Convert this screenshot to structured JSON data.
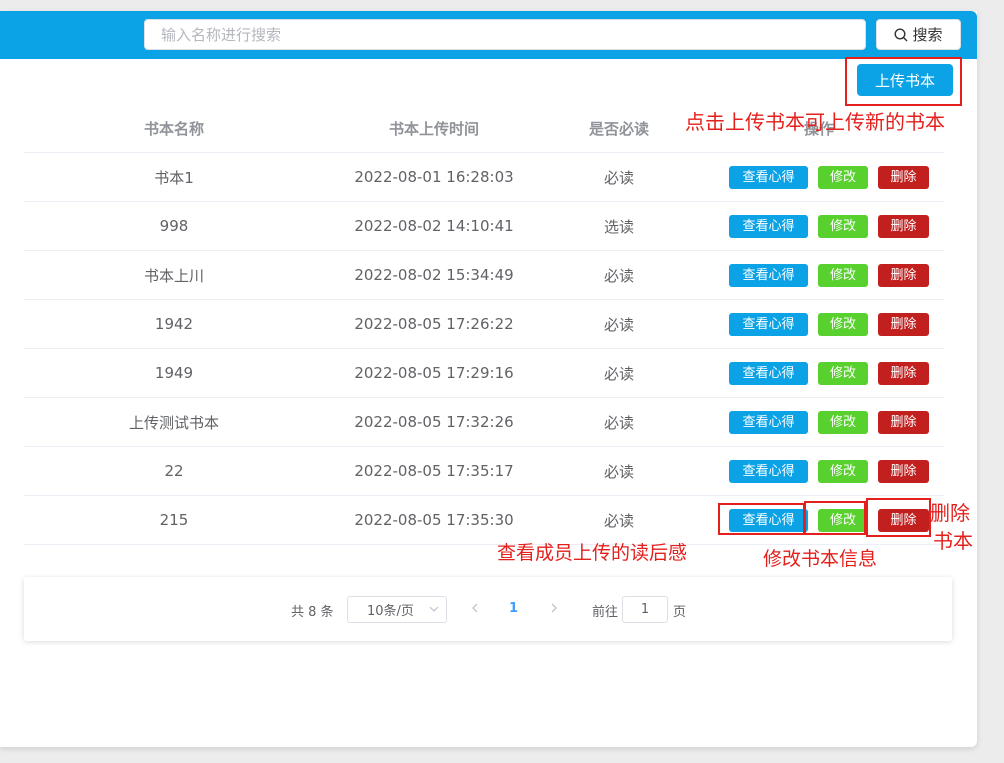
{
  "search": {
    "placeholder": "输入名称进行搜索",
    "value": "",
    "button_label": "搜索"
  },
  "upload_label": "上传书本",
  "table": {
    "headers": [
      "书本名称",
      "书本上传时间",
      "是否必读",
      "操作"
    ],
    "rows": [
      {
        "name": "书本1",
        "time": "2022-08-01 16:28:03",
        "required": "必读"
      },
      {
        "name": "998",
        "time": "2022-08-02 14:10:41",
        "required": "选读"
      },
      {
        "name": "书本上川",
        "time": "2022-08-02 15:34:49",
        "required": "必读"
      },
      {
        "name": "1942",
        "time": "2022-08-05 17:26:22",
        "required": "必读"
      },
      {
        "name": "1949",
        "time": "2022-08-05 17:29:16",
        "required": "必读"
      },
      {
        "name": "上传测试书本",
        "time": "2022-08-05 17:32:26",
        "required": "必读"
      },
      {
        "name": "22",
        "time": "2022-08-05 17:35:17",
        "required": "必读"
      },
      {
        "name": "215",
        "time": "2022-08-05 17:35:30",
        "required": "必读"
      }
    ],
    "actions": {
      "view": "查看心得",
      "edit": "修改",
      "delete": "删除"
    }
  },
  "pagination": {
    "total": "共 8 条",
    "page_size": "10条/页",
    "current_page": "1",
    "goto_label": "前往",
    "goto_value": "1",
    "goto_unit": "页"
  },
  "annotations": {
    "upload": "点击上传书本可上传新的书本",
    "view": "查看成员上传的读后感",
    "edit": "修改书本信息",
    "delete_line1": "删除",
    "delete_line2": "书本"
  },
  "colors": {
    "primary": "#0ba3e6",
    "edit": "#58d02e",
    "delete": "#c21f1f",
    "annotation": "#e4201c",
    "page_active": "#409eff"
  },
  "icons": [
    "search-icon",
    "chevron-down-icon",
    "chevron-left-icon",
    "chevron-right-icon"
  ]
}
